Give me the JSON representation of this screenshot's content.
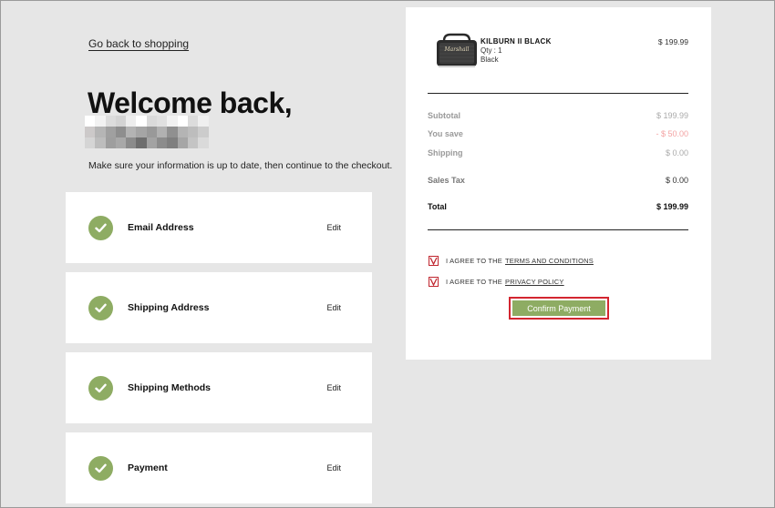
{
  "nav": {
    "back_label": "Go back to shopping"
  },
  "greeting": {
    "title": "Welcome back,",
    "pixel_colors": [
      "#ffffff",
      "#f2f2f2",
      "#dcdcdc",
      "#d3d3d3",
      "#ededed",
      "#ffffff",
      "#dadada",
      "#e0e0e0",
      "#f1f1f1",
      "#ffffff",
      "#dcdcdc",
      "#efefef",
      "#ccc9c9",
      "#b5b5b5",
      "#a0a0a0",
      "#8e8e8e",
      "#b3b3b3",
      "#a5a5a5",
      "#999999",
      "#b1b1b1",
      "#909090",
      "#b4b4b4",
      "#bdbdbd",
      "#cccccc",
      "#d5d5d5",
      "#bdbdbd",
      "#9e9e9e",
      "#a8a8a8",
      "#8b8b8b",
      "#6e6e6e",
      "#a3a3a3",
      "#8c8c8c",
      "#7f7f7f",
      "#a6a6a6",
      "#c4c4c4",
      "#dadada"
    ]
  },
  "intro": "Make sure your information is up to date, then continue to the checkout.",
  "steps": [
    {
      "label": "Email Address",
      "edit": "Edit"
    },
    {
      "label": "Shipping Address",
      "edit": "Edit"
    },
    {
      "label": "Shipping Methods",
      "edit": "Edit"
    },
    {
      "label": "Payment",
      "edit": "Edit"
    }
  ],
  "colors": {
    "accent_green": "#8eac63",
    "highlight_red": "#d32630",
    "savings_red": "#f3a3a3"
  },
  "product": {
    "name": "KILBURN II BLACK",
    "qty": "Qty : 1",
    "color": "Black",
    "price": "$ 199.99",
    "brand_mark": "Marshall"
  },
  "totals": {
    "subtotal_label": "Subtotal",
    "subtotal_value": "$ 199.99",
    "save_label": "You save",
    "save_value": "- $ 50.00",
    "shipping_label": "Shipping",
    "shipping_value": "$ 0.00",
    "tax_label": "Sales Tax",
    "tax_value": "$ 0.00",
    "total_label": "Total",
    "total_value": "$ 199.99"
  },
  "agreements": {
    "prefix": "I AGREE TO THE",
    "terms_link": "TERMS AND CONDITIONS",
    "privacy_link": "PRIVACY POLICY"
  },
  "confirm_label": "Confirm Payment"
}
